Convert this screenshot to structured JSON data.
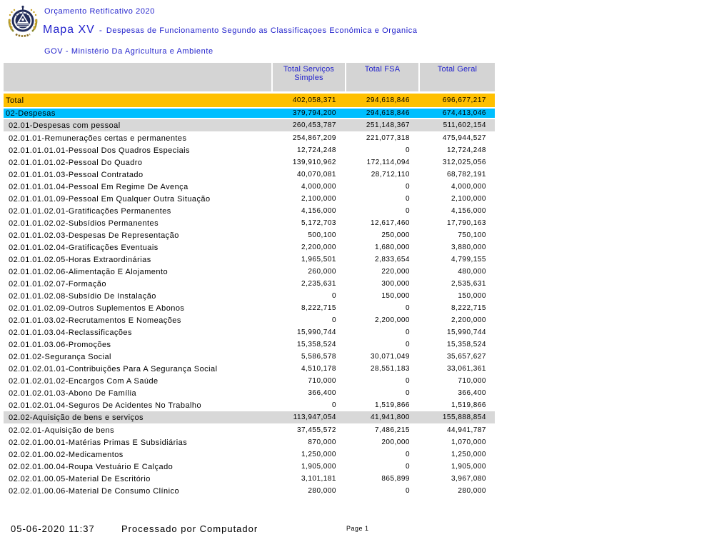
{
  "header": {
    "title": "Orçamento Retificativo 2020",
    "map_label": "Mapa XV",
    "separator": "-",
    "map_subtitle": "Despesas de Funcionamento Segundo as Classificaçoes Económica e Organica",
    "org_line": "GOV - Ministério Da Agricultura e Ambiente"
  },
  "logo": {
    "name": "cape-verde-national-emblem"
  },
  "colors": {
    "title_blue": "#2222CC",
    "total_row_orange": "#FFC000",
    "section_row_cyan": "#00BFFF",
    "header_gray": "#D4D4D4",
    "subtotal_gray": "#D8D8D8"
  },
  "table": {
    "columns": [
      "Total Serviços Simples",
      "Total FSA",
      "Total Geral"
    ],
    "rows": [
      {
        "style": "total",
        "label": "Total",
        "values": [
          "402,058,371",
          "294,618,846",
          "696,677,217"
        ]
      },
      {
        "style": "section",
        "label": "02-Despesas",
        "values": [
          "379,794,200",
          "294,618,846",
          "674,413,046"
        ]
      },
      {
        "style": "subtotal",
        "label": "02.01-Despesas com pessoal",
        "values": [
          "260,453,787",
          "251,148,367",
          "511,602,154"
        ]
      },
      {
        "style": "plain",
        "label": "02.01.01-Remunerações certas e permanentes",
        "values": [
          "254,867,209",
          "221,077,318",
          "475,944,527"
        ]
      },
      {
        "style": "plain",
        "label": "02.01.01.01.01-Pessoal Dos Quadros Especiais",
        "values": [
          "12,724,248",
          "0",
          "12,724,248"
        ]
      },
      {
        "style": "plain",
        "label": "02.01.01.01.02-Pessoal Do Quadro",
        "values": [
          "139,910,962",
          "172,114,094",
          "312,025,056"
        ]
      },
      {
        "style": "plain",
        "label": "02.01.01.01.03-Pessoal Contratado",
        "values": [
          "40,070,081",
          "28,712,110",
          "68,782,191"
        ]
      },
      {
        "style": "plain",
        "label": "02.01.01.01.04-Pessoal Em Regime De Avença",
        "values": [
          "4,000,000",
          "0",
          "4,000,000"
        ]
      },
      {
        "style": "plain",
        "label": "02.01.01.01.09-Pessoal Em Qualquer Outra Situação",
        "values": [
          "2,100,000",
          "0",
          "2,100,000"
        ]
      },
      {
        "style": "plain",
        "label": "02.01.01.02.01-Gratificações Permanentes",
        "values": [
          "4,156,000",
          "0",
          "4,156,000"
        ]
      },
      {
        "style": "plain",
        "label": "02.01.01.02.02-Subsídios Permanentes",
        "values": [
          "5,172,703",
          "12,617,460",
          "17,790,163"
        ]
      },
      {
        "style": "plain",
        "label": "02.01.01.02.03-Despesas De Representação",
        "values": [
          "500,100",
          "250,000",
          "750,100"
        ]
      },
      {
        "style": "plain",
        "label": "02.01.01.02.04-Gratificações Eventuais",
        "values": [
          "2,200,000",
          "1,680,000",
          "3,880,000"
        ]
      },
      {
        "style": "plain",
        "label": "02.01.01.02.05-Horas Extraordinárias",
        "values": [
          "1,965,501",
          "2,833,654",
          "4,799,155"
        ]
      },
      {
        "style": "plain",
        "label": "02.01.01.02.06-Alimentação E Alojamento",
        "values": [
          "260,000",
          "220,000",
          "480,000"
        ]
      },
      {
        "style": "plain",
        "label": "02.01.01.02.07-Formação",
        "values": [
          "2,235,631",
          "300,000",
          "2,535,631"
        ]
      },
      {
        "style": "plain",
        "label": "02.01.01.02.08-Subsídio De Instalação",
        "values": [
          "0",
          "150,000",
          "150,000"
        ]
      },
      {
        "style": "plain",
        "label": "02.01.01.02.09-Outros Suplementos E Abonos",
        "values": [
          "8,222,715",
          "0",
          "8,222,715"
        ]
      },
      {
        "style": "plain",
        "label": "02.01.01.03.02-Recrutamentos E Nomeações",
        "values": [
          "0",
          "2,200,000",
          "2,200,000"
        ]
      },
      {
        "style": "plain",
        "label": "02.01.01.03.04-Reclassificações",
        "values": [
          "15,990,744",
          "0",
          "15,990,744"
        ]
      },
      {
        "style": "plain",
        "label": "02.01.01.03.06-Promoções",
        "values": [
          "15,358,524",
          "0",
          "15,358,524"
        ]
      },
      {
        "style": "plain",
        "label": "02.01.02-Segurança Social",
        "values": [
          "5,586,578",
          "30,071,049",
          "35,657,627"
        ]
      },
      {
        "style": "plain",
        "label": "02.01.02.01.01-Contribuições Para A Segurança Social",
        "values": [
          "4,510,178",
          "28,551,183",
          "33,061,361"
        ]
      },
      {
        "style": "plain",
        "label": "02.01.02.01.02-Encargos Com A Saúde",
        "values": [
          "710,000",
          "0",
          "710,000"
        ]
      },
      {
        "style": "plain",
        "label": "02.01.02.01.03-Abono De Família",
        "values": [
          "366,400",
          "0",
          "366,400"
        ]
      },
      {
        "style": "plain",
        "label": "02.01.02.01.04-Seguros De Acidentes No Trabalho",
        "values": [
          "0",
          "1,519,866",
          "1,519,866"
        ]
      },
      {
        "style": "subtotal",
        "label": "02.02-Aquisição de bens e serviços",
        "values": [
          "113,947,054",
          "41,941,800",
          "155,888,854"
        ]
      },
      {
        "style": "plain",
        "label": "02.02.01-Aquisição de bens",
        "values": [
          "37,455,572",
          "7,486,215",
          "44,941,787"
        ]
      },
      {
        "style": "plain",
        "label": "02.02.01.00.01-Matérias Primas E Subsidiárias",
        "values": [
          "870,000",
          "200,000",
          "1,070,000"
        ]
      },
      {
        "style": "plain",
        "label": "02.02.01.00.02-Medicamentos",
        "values": [
          "1,250,000",
          "0",
          "1,250,000"
        ]
      },
      {
        "style": "plain",
        "label": "02.02.01.00.04-Roupa Vestuário E Calçado",
        "values": [
          "1,905,000",
          "0",
          "1,905,000"
        ]
      },
      {
        "style": "plain",
        "label": "02.02.01.00.05-Material De Escritório",
        "values": [
          "3,101,181",
          "865,899",
          "3,967,080"
        ]
      },
      {
        "style": "plain",
        "label": "02.02.01.00.06-Material De Consumo Clínico",
        "values": [
          "280,000",
          "0",
          "280,000"
        ]
      }
    ]
  },
  "footer": {
    "datetime": "05-06-2020 11:37",
    "processed": "Processado por Computador",
    "page": "Page 1"
  }
}
